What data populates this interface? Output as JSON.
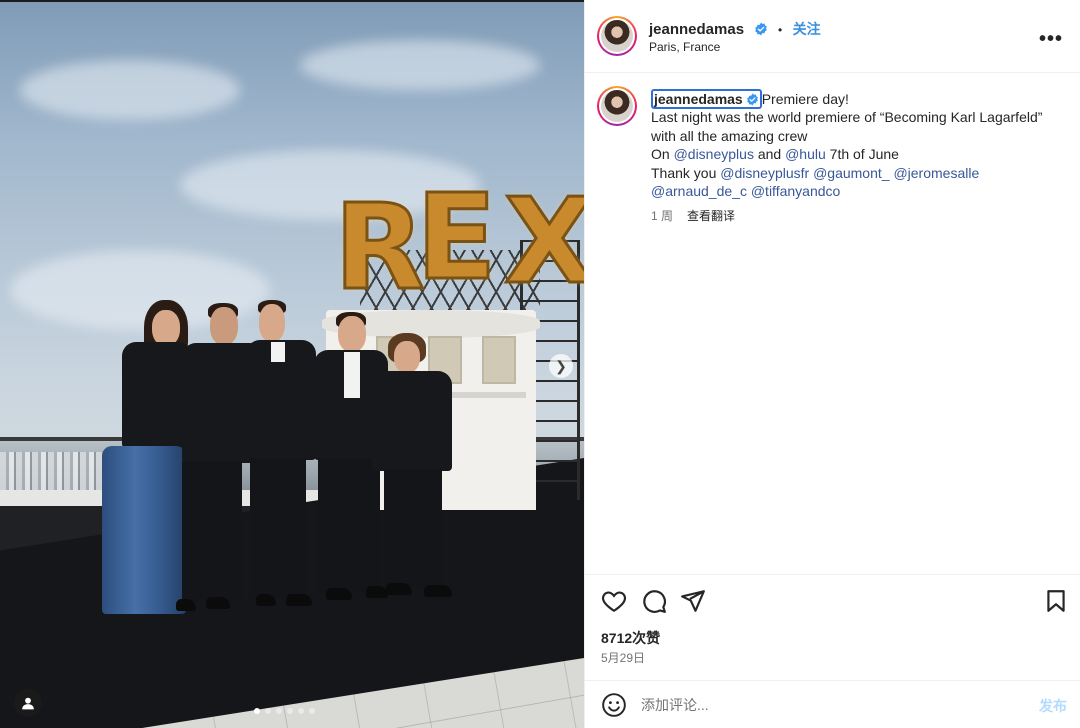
{
  "post": {
    "username": "jeannedamas",
    "verified": true,
    "follow_label": "关注",
    "separator": "•",
    "location": "Paris, France",
    "more_label": "•••"
  },
  "caption": {
    "username": "jeannedamas",
    "line1": "Premiere day!",
    "line2": "Last night was the world premiere of “Becoming Karl Lagarfeld” with all the amazing crew",
    "line3_prefix": "On ",
    "line3_mention1": "@disneyplus",
    "line3_mid": " and ",
    "line3_mention2": "@hulu",
    "line3_suffix": " 7th of June",
    "line4_prefix": "Thank you ",
    "thanks": [
      "@disneyplusfr",
      "@gaumont_",
      "@jeromesalle",
      "@arnaud_de_c",
      "@tiffanyandco"
    ],
    "age": "1 周",
    "translate_label": "查看翻译"
  },
  "engagement": {
    "likes": "8712次赞",
    "date": "5月29日"
  },
  "comment": {
    "placeholder": "添加评论...",
    "post_label": "发布"
  },
  "image": {
    "sign_letters": [
      "R",
      "E",
      "X"
    ],
    "carousel_dots": 6,
    "active_dot": 0
  },
  "colors": {
    "accent": "#3a8fe0",
    "mention": "#385898",
    "muted": "#737373",
    "sign": "#c88a2c",
    "focus_outline": "#2f6fd6"
  },
  "icons": {
    "verified": "verified-badge-icon",
    "more": "more-options-icon",
    "like": "heart-icon",
    "comment": "comment-bubble-icon",
    "share": "paper-plane-icon",
    "save": "bookmark-icon",
    "emoji": "smiley-icon",
    "tagged": "user-tag-icon",
    "next": "chevron-right-icon"
  }
}
